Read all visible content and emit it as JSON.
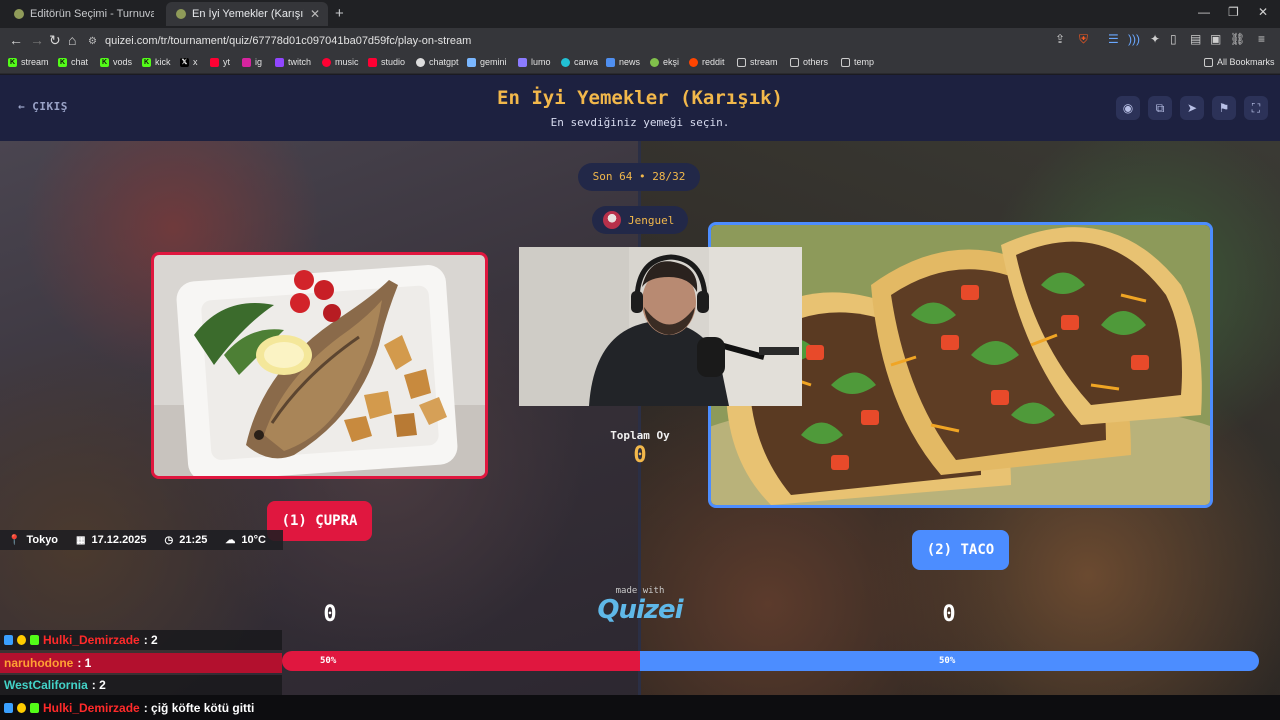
{
  "browser": {
    "tabs": [
      {
        "title": "Editörün Seçimi - Turnuva - Quizei",
        "active": false
      },
      {
        "title": "En İyi Yemekler (Karışık) - Tier Li",
        "active": true
      }
    ],
    "url": "quizei.com/tr/tournament/quiz/67778d01c097041ba07d59fc/play-on-stream",
    "bookmarks": [
      "stream",
      "chat",
      "vods",
      "kick",
      "x",
      "yt",
      "ig",
      "twitch",
      "music",
      "studio",
      "chatgpt",
      "gemini",
      "lumo",
      "canva",
      "news",
      "ekşi",
      "reddit",
      "stream",
      "others",
      "temp"
    ],
    "all_bookmarks": "All Bookmarks"
  },
  "header": {
    "exit_label": "ÇIKIŞ",
    "title": "En İyi Yemekler (Karışık)",
    "subtitle": "En sevdiğiniz yemeği seçin."
  },
  "match": {
    "round": "Son 64 • 28/32",
    "streamer": "Jenguel",
    "total_label": "Toplam Oy",
    "total_votes": "0",
    "left": {
      "label": "(1) ÇUPRA",
      "votes": "0",
      "percent": "50%"
    },
    "right": {
      "label": "(2) TACO",
      "votes": "0",
      "percent": "50%"
    },
    "made_with": "made with",
    "brand": "Quizei"
  },
  "overlay": {
    "location": "Tokyo",
    "date": "17.12.2025",
    "time": "21:25",
    "weather": "10°C",
    "chat": [
      {
        "user": "Hulki_Demirzade",
        "text": ": 2",
        "color": "#ff2a2a"
      },
      {
        "user": "naruhodone",
        "text": ": 1",
        "color": "#ffa033"
      },
      {
        "user": "WestCalifornia",
        "text": ": 2",
        "color": "#43d3c8"
      }
    ],
    "bottom_chat": {
      "user": "Hulki_Demirzade",
      "text": ": çiğ köfte kötü gitti",
      "color": "#ff2a2a"
    }
  },
  "colors": {
    "red": "#e0173f",
    "blue": "#4c8dff",
    "gold": "#f2b84b",
    "header_bg": "#1d2140"
  }
}
